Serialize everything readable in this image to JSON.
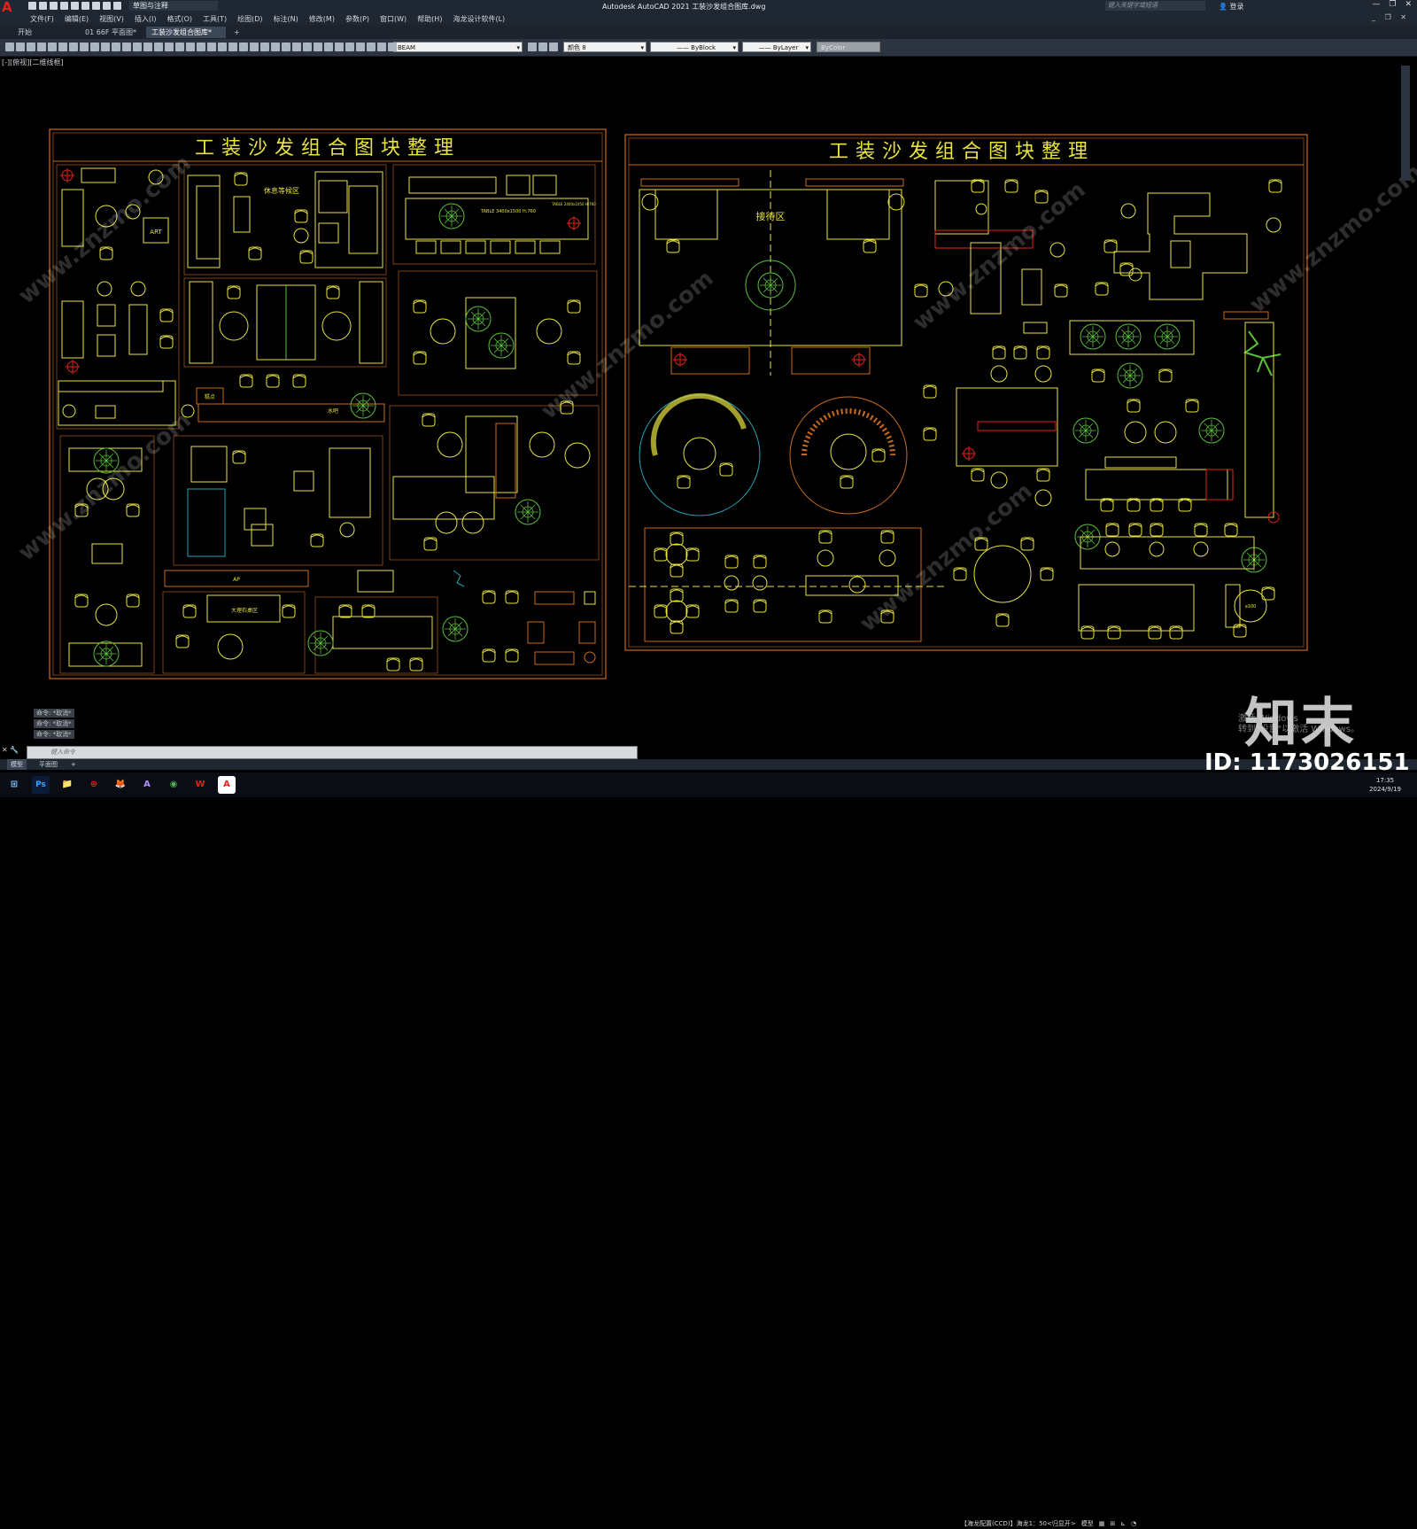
{
  "app": {
    "logo": "A",
    "workspace": "草图与注释",
    "title": "Autodesk AutoCAD 2021   工装沙发组合图库.dwg",
    "search_placeholder": "键入关键字或短语",
    "login": "登录",
    "window_controls": [
      "—",
      "❐",
      "✕"
    ]
  },
  "menu": [
    "文件(F)",
    "编辑(E)",
    "视图(V)",
    "插入(I)",
    "格式(O)",
    "工具(T)",
    "绘图(D)",
    "标注(N)",
    "修改(M)",
    "参数(P)",
    "窗口(W)",
    "帮助(H)",
    "海龙设计软件(L)"
  ],
  "doc_tabs": [
    {
      "label": "开始",
      "active": false
    },
    {
      "label": "01 66F 平面图*",
      "active": false
    },
    {
      "label": "工装沙发组合图库*",
      "active": true
    }
  ],
  "toolbar": {
    "layer": "BEAM",
    "color": "颜色 8",
    "linetype": "ByBlock",
    "lineweight": "ByLayer",
    "plotstyle": "ByColor"
  },
  "viewport_label": "[-][俯视][二维线框]",
  "drawing": {
    "left_title": "工装沙发组合图块整理",
    "right_title": "工装沙发组合图块整理",
    "labels": {
      "lounge": "休息等候区",
      "reception": "接待区",
      "art": "ART",
      "snack": "糕点",
      "bar": "水吧",
      "table_note": "TABLE 3400x1500 H:760",
      "table_note2": "TABLE 2400x1050 H:760",
      "meeting": "大理石桌区",
      "bench": "AP",
      "sofa_note": "a100"
    },
    "watermark": "www.znzmo.com"
  },
  "command": {
    "history": [
      "命令: *取消*",
      "命令: *取消*",
      "命令: *取消*"
    ],
    "placeholder": "键入命令"
  },
  "layout_tabs": [
    {
      "label": "模型",
      "active": true
    },
    {
      "label": "平面图",
      "active": false
    },
    {
      "label": "+",
      "active": false
    }
  ],
  "status": {
    "annotation": "【海龙配置(CCD)】海龙1：50<归显开>",
    "mode": "模型"
  },
  "taskbar": {
    "apps": [
      "Ps",
      "📁",
      "⊛",
      "🦊",
      "A",
      "◉",
      "W",
      "A"
    ],
    "time": "17:35",
    "date": "2024/9/19"
  },
  "overlay": {
    "brand": "知末",
    "id": "ID: 1173026151",
    "activate": "激活 Windows\n转到\"设置\"以激活 Windows。"
  },
  "colors": {
    "ui_dark": "#1f2732",
    "cad_yellow": "#e8e340",
    "cad_red": "#e2231a",
    "cad_orange": "#c96b1c",
    "cad_green": "#5bbf3a",
    "cad_cyan": "#1fa3b3"
  }
}
